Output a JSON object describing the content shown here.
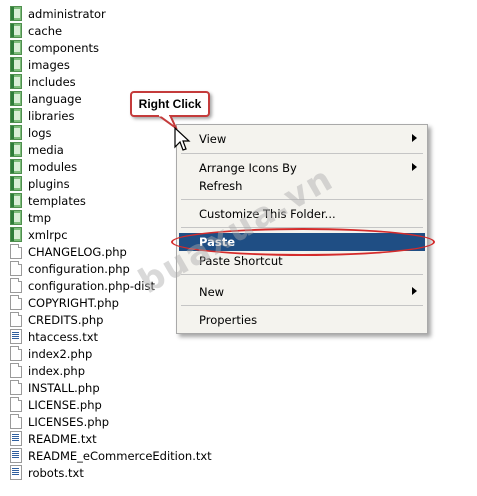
{
  "files": [
    {
      "name": "administrator",
      "type": "folder"
    },
    {
      "name": "cache",
      "type": "folder"
    },
    {
      "name": "components",
      "type": "folder"
    },
    {
      "name": "images",
      "type": "folder"
    },
    {
      "name": "includes",
      "type": "folder"
    },
    {
      "name": "language",
      "type": "folder"
    },
    {
      "name": "libraries",
      "type": "folder"
    },
    {
      "name": "logs",
      "type": "folder"
    },
    {
      "name": "media",
      "type": "folder"
    },
    {
      "name": "modules",
      "type": "folder"
    },
    {
      "name": "plugins",
      "type": "folder"
    },
    {
      "name": "templates",
      "type": "folder"
    },
    {
      "name": "tmp",
      "type": "folder"
    },
    {
      "name": "xmlrpc",
      "type": "folder"
    },
    {
      "name": "CHANGELOG.php",
      "type": "doc"
    },
    {
      "name": "configuration.php",
      "type": "doc"
    },
    {
      "name": "configuration.php-dist",
      "type": "doc"
    },
    {
      "name": "COPYRIGHT.php",
      "type": "doc"
    },
    {
      "name": "CREDITS.php",
      "type": "doc"
    },
    {
      "name": "htaccess.txt",
      "type": "txt"
    },
    {
      "name": "index2.php",
      "type": "doc"
    },
    {
      "name": "index.php",
      "type": "doc"
    },
    {
      "name": "INSTALL.php",
      "type": "doc"
    },
    {
      "name": "LICENSE.php",
      "type": "doc"
    },
    {
      "name": "LICENSES.php",
      "type": "doc"
    },
    {
      "name": "README.txt",
      "type": "txt"
    },
    {
      "name": "README_eCommerceEdition.txt",
      "type": "txt"
    },
    {
      "name": "robots.txt",
      "type": "txt"
    }
  ],
  "context_menu": {
    "view": "View",
    "arrange_icons_by": "Arrange Icons By",
    "refresh": "Refresh",
    "customize_folder": "Customize This Folder...",
    "paste": "Paste",
    "paste_shortcut": "Paste Shortcut",
    "new": "New",
    "properties": "Properties"
  },
  "callout": {
    "label": "Right Click"
  },
  "watermark": "buaxua.vn",
  "colors": {
    "highlight": "#1f4e84",
    "annotation_red": "#d42b2b"
  }
}
